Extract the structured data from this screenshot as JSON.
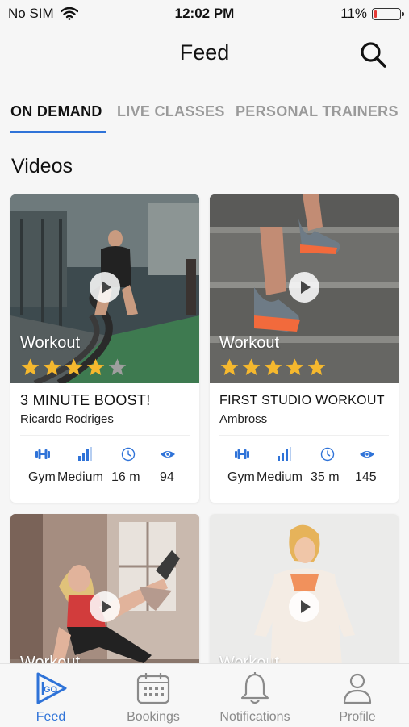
{
  "status_bar": {
    "carrier": "No SIM",
    "time": "12:02 PM",
    "battery": "11%",
    "battery_level": 0.11
  },
  "header": {
    "title": "Feed",
    "search_icon": "search-icon"
  },
  "tabs": [
    {
      "label": "ON DEMAND",
      "active": true
    },
    {
      "label": "LIVE CLASSES",
      "active": false
    },
    {
      "label": "PERSONAL TRAINERS",
      "active": false
    }
  ],
  "section": {
    "title": "Videos"
  },
  "videos": [
    {
      "category": "Workout",
      "title": "3 MINUTE  BOOST!",
      "author": "Ricardo Rodriges",
      "rating": 4,
      "equipment": "Gym",
      "level": "Medium",
      "duration": "16 m",
      "views": "94"
    },
    {
      "category": "Workout",
      "title": "FIRST STUDIO WORKOUT",
      "author": "Ambross",
      "rating": 5,
      "equipment": "Gym",
      "level": "Medium",
      "duration": "35 m",
      "views": "145"
    },
    {
      "category": "Workout"
    },
    {
      "category": "Workout"
    }
  ],
  "colors": {
    "accent": "#2f73d8",
    "star": "#f5b82e",
    "star_empty": "#9e9e9e",
    "battery_low": "#e53935"
  },
  "bottom_nav": [
    {
      "label": "Feed",
      "icon": "feed-logo-icon",
      "active": true
    },
    {
      "label": "Bookings",
      "icon": "calendar-icon",
      "active": false
    },
    {
      "label": "Notifications",
      "icon": "bell-icon",
      "active": false
    },
    {
      "label": "Profile",
      "icon": "person-icon",
      "active": false
    }
  ]
}
